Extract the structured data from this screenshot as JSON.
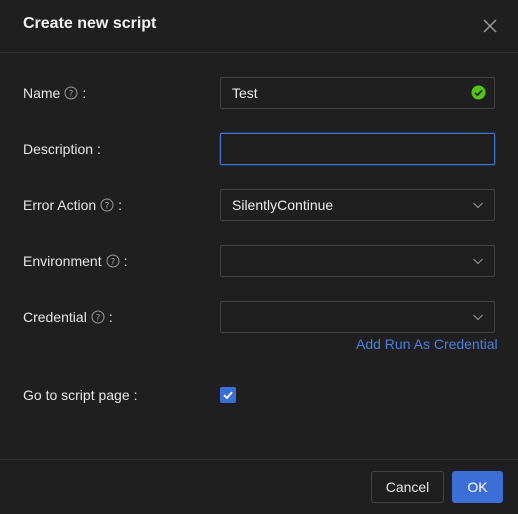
{
  "dialog": {
    "title": "Create new script",
    "close_icon": "close-icon"
  },
  "form": {
    "name": {
      "label": "Name",
      "colon": ":",
      "value": "Test",
      "status": "valid"
    },
    "description": {
      "label": "Description",
      "colon": ":",
      "value": "",
      "placeholder": ""
    },
    "error_action": {
      "label": "Error Action",
      "colon": ":",
      "value": "SilentlyContinue"
    },
    "environment": {
      "label": "Environment",
      "colon": ":",
      "value": ""
    },
    "credential": {
      "label": "Credential",
      "colon": ":",
      "value": "",
      "link": "Add Run As Credential"
    },
    "go_to_script_page": {
      "label": "Go to script page",
      "colon": ":",
      "checked": true
    }
  },
  "footer": {
    "cancel_label": "Cancel",
    "ok_label": "OK"
  },
  "colors": {
    "background": "#1f1f1f",
    "accent": "#3c6fd6",
    "success": "#52c41a",
    "link": "#4a7fe0"
  }
}
